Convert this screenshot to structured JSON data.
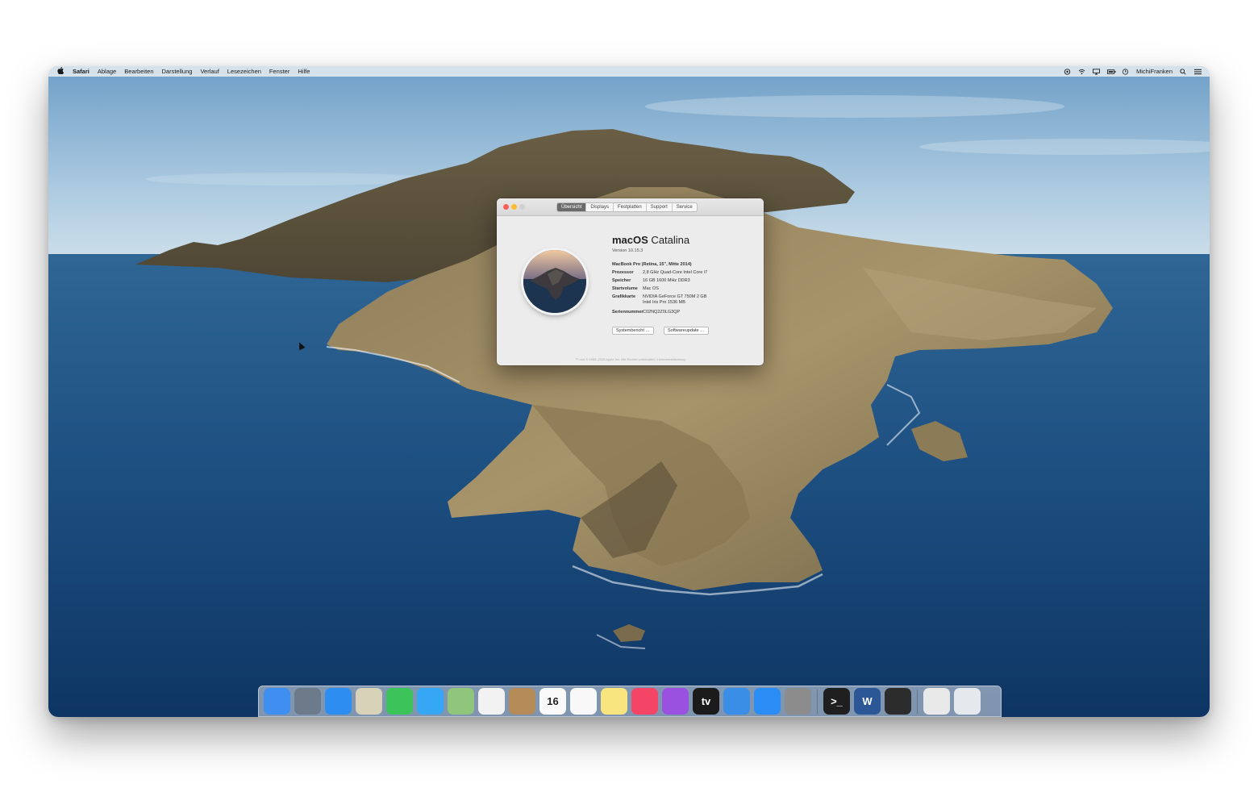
{
  "menubar": {
    "apple": "",
    "app": "Safari",
    "items": [
      "Ablage",
      "Bearbeiten",
      "Darstellung",
      "Verlauf",
      "Lesezeichen",
      "Fenster",
      "Hilfe"
    ],
    "user": "MichiFranken",
    "status_icons": [
      "control-icon",
      "wifi-icon",
      "airplay-icon",
      "battery-icon",
      "clock-icon"
    ]
  },
  "about": {
    "tabs": [
      "Übersicht",
      "Displays",
      "Festplatten",
      "Support",
      "Service"
    ],
    "active_tab": "Übersicht",
    "os_name_bold": "macOS",
    "os_name_rest": " Catalina",
    "version": "Version 10.15.3",
    "model": "MacBook Pro (Retina, 15\", Mitte 2014)",
    "specs": [
      {
        "key": "Prozessor",
        "value": "2,8 GHz Quad-Core Intel Core i7"
      },
      {
        "key": "Speicher",
        "value": "16 GB 1600 MHz DDR3"
      },
      {
        "key": "Startvolume",
        "value": "Mac OS"
      },
      {
        "key": "Grafikkarte",
        "value": "NVIDIA GeForce GT 750M 2 GB",
        "value2": "Intel Iris Pro 1536 MB"
      },
      {
        "key": "Seriennummer",
        "value": "C02NQ2Z0LG3QP"
      }
    ],
    "buttons": {
      "system_report": "Systembericht …",
      "software_update": "Softwareupdate …"
    },
    "footer": "™ und © 1983–2020 Apple Inc. Alle Rechte vorbehalten. Lizenzvereinbarung"
  },
  "dock": {
    "apps": [
      {
        "name": "finder-icon",
        "color": "#3f8ff0"
      },
      {
        "name": "launchpad-icon",
        "color": "#6d7a8a"
      },
      {
        "name": "safari-icon",
        "color": "#2e8df0"
      },
      {
        "name": "preview-icon",
        "color": "#d8d2b8"
      },
      {
        "name": "facetime-icon",
        "color": "#3cc35a"
      },
      {
        "name": "messages-icon",
        "color": "#35a7f5"
      },
      {
        "name": "maps-icon",
        "color": "#8fc67c"
      },
      {
        "name": "photos-icon",
        "color": "#f2f2f2"
      },
      {
        "name": "contacts-icon",
        "color": "#b58b57"
      },
      {
        "name": "calendar-icon",
        "color": "#fafafa",
        "label": "16"
      },
      {
        "name": "reminders-icon",
        "color": "#f8f8f8"
      },
      {
        "name": "notes-icon",
        "color": "#f8e580"
      },
      {
        "name": "music-icon",
        "color": "#f54566"
      },
      {
        "name": "podcasts-icon",
        "color": "#9b51e0"
      },
      {
        "name": "tv-icon",
        "color": "#1b1b1b",
        "label": "tv"
      },
      {
        "name": "keynote-icon",
        "color": "#3a8ee6"
      },
      {
        "name": "app-store-icon",
        "color": "#2a8df5"
      },
      {
        "name": "system-preferences-icon",
        "color": "#8c8c8c"
      }
    ],
    "extras": [
      {
        "name": "terminal-icon",
        "color": "#1f1f1f",
        "label": ">_"
      },
      {
        "name": "word-icon",
        "color": "#2b5797",
        "label": "W"
      },
      {
        "name": "screen-recorder-icon",
        "color": "#2c2c2c"
      }
    ],
    "right": [
      {
        "name": "screenshot-icon",
        "color": "#e9e9e9"
      },
      {
        "name": "trash-icon",
        "color": "#e5e8ec"
      }
    ]
  }
}
